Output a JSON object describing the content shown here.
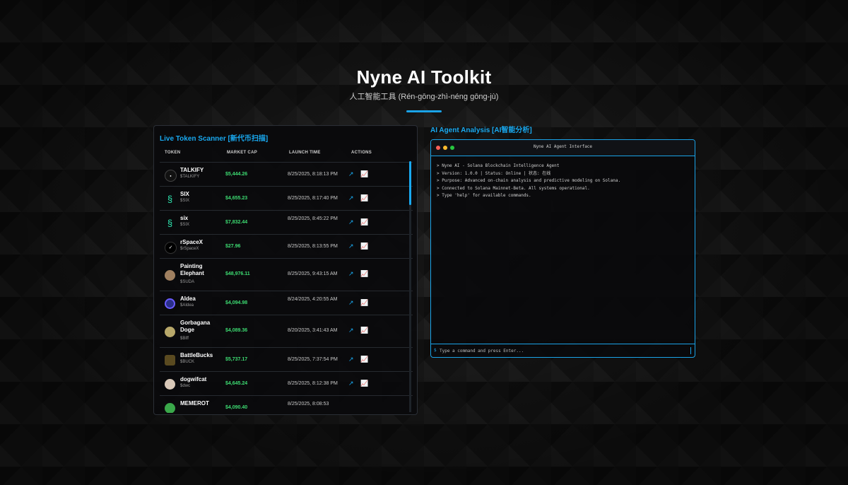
{
  "header": {
    "title": "Nyne AI Toolkit",
    "subtitle": "人工智能工具 (Rén-gōng-zhì-néng gōng-jù)"
  },
  "scanner": {
    "title": "Live Token Scanner [新代币扫描]",
    "columns": [
      "TOKEN",
      "MARKET CAP",
      "LAUNCH TIME",
      "ACTIONS"
    ],
    "rows": [
      {
        "name": "TALKIFY",
        "symbol": "$TALKIFY",
        "market_cap": "$5,444.26",
        "launch_time": "8/25/2025, 8:18:13 PM",
        "icon": "talkify-logo"
      },
      {
        "name": "SIX",
        "symbol": "$SIX",
        "market_cap": "$4,655.23",
        "launch_time": "8/25/2025, 8:17:40 PM",
        "icon": "six-logo"
      },
      {
        "name": "six",
        "symbol": "$SIX",
        "market_cap": "$7,832.44",
        "launch_time": "8/25/2025, 8:45:22 PM",
        "icon": "six-logo"
      },
      {
        "name": "rSpaceX",
        "symbol": "$rSpaceX",
        "market_cap": "$27.96",
        "launch_time": "8/25/2025, 8:13:55 PM",
        "icon": "rspacex-logo"
      },
      {
        "name": "Painting Elephant",
        "symbol": "$SUDA",
        "market_cap": "$48,976.11",
        "launch_time": "8/25/2025, 9:43:15 AM",
        "icon": "elephant-avatar"
      },
      {
        "name": "AIdea",
        "symbol": "$AIdea",
        "market_cap": "$4,094.98",
        "launch_time": "8/24/2025, 4:20:55 AM",
        "icon": "aidea-logo"
      },
      {
        "name": "Gorbagana Doge",
        "symbol": "$Biff",
        "market_cap": "$4,089.36",
        "launch_time": "8/20/2025, 3:41:43 AM",
        "icon": "doge-avatar"
      },
      {
        "name": "BattleBucks",
        "symbol": "$BUCK",
        "market_cap": "$5,737.17",
        "launch_time": "8/25/2025, 7:37:54 PM",
        "icon": "battlebucks-logo"
      },
      {
        "name": "dogwifcat",
        "symbol": "$dwc",
        "market_cap": "$4,645.24",
        "launch_time": "8/25/2025, 8:12:38 PM",
        "icon": "dogwifcat-avatar"
      },
      {
        "name": "MEMEROT",
        "symbol": "",
        "market_cap": "$4,090.40",
        "launch_time": "8/25/2025, 8:08:53",
        "icon": "memerot-logo"
      }
    ],
    "actions": {
      "open": "external-link-icon",
      "chart": "chart-icon"
    }
  },
  "agent": {
    "title": "AI Agent Analysis [AI智能分析]",
    "window_title": "Nyne AI Agent Interface",
    "log": [
      "> Nyne AI - Solana Blockchain Intelligence Agent",
      "> Version: 1.0.0 | Status: Online | 状态: 在线",
      "> Purpose: Advanced on-chain analysis and predictive modeling on Solana.",
      "> Connected to Solana Mainnet-Beta. All systems operational.",
      "> Type 'help' for available commands."
    ],
    "prompt": "$",
    "input_placeholder": "Type a command and press Enter...",
    "window_dots": [
      "#ff5f57",
      "#febc2e",
      "#28c840"
    ]
  },
  "colors": {
    "accent": "#1aa3e8",
    "positive": "#3ddc72"
  }
}
